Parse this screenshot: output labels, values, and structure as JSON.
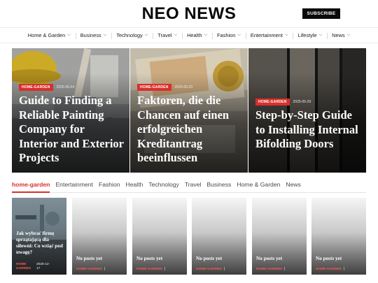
{
  "site": {
    "logo": "NEO NEWS",
    "subscribe_label": "SUBSCRIBE"
  },
  "nav": [
    {
      "label": "Home & Garden",
      "icon": "chevron-down-icon"
    },
    {
      "label": "Business",
      "icon": "chevron-down-icon"
    },
    {
      "label": "Technology",
      "icon": "chevron-down-icon"
    },
    {
      "label": "Travel",
      "icon": "chevron-down-icon"
    },
    {
      "label": "Health",
      "icon": "chevron-down-icon"
    },
    {
      "label": "Fashion",
      "icon": "chevron-down-icon"
    },
    {
      "label": "Entertainment",
      "icon": "chevron-down-icon"
    },
    {
      "label": "Lifestyle",
      "icon": "chevron-down-icon"
    },
    {
      "label": "News",
      "icon": "chevron-down-icon"
    }
  ],
  "hero": [
    {
      "tag": "HOME-GARDEN",
      "date": "2025-06-24",
      "title": "Guide to Finding a Reliable Painting Company for Interior and Exterior Projects"
    },
    {
      "tag": "HOME-GARDEN",
      "date": "2025-06-23",
      "title": "Faktoren, die die Chancen auf einen erfolgreichen Kreditantrag beeinflussen"
    },
    {
      "tag": "HOME-GARDEN",
      "date": "2025-05-29",
      "title": "Step-by-Step Guide to Installing Internal Bifolding Doors"
    }
  ],
  "tabs": [
    "home-garden",
    "Entertainment",
    "Fashion",
    "Health",
    "Technology",
    "Travel",
    "Business",
    "Home & Garden",
    "News"
  ],
  "posts": [
    {
      "title": "Jak wybrać firmę sprzątającą dla siłowni: Co wziąć pod uwagę?",
      "tag": "HOME GARDEN",
      "date": "2025-12-17"
    },
    {
      "title": "No posts yet",
      "tag": "HOME-GARDEN",
      "date": ""
    },
    {
      "title": "No posts yet",
      "tag": "HOME-GARDEN",
      "date": ""
    },
    {
      "title": "No posts yet",
      "tag": "HOME-GARDEN",
      "date": ""
    },
    {
      "title": "No posts yet",
      "tag": "HOME-GARDEN",
      "date": ""
    },
    {
      "title": "No posts yet",
      "tag": "HOME-GARDEN",
      "date": ""
    }
  ],
  "colors": {
    "accent": "#d7302b",
    "dark": "#0a0a0a"
  }
}
